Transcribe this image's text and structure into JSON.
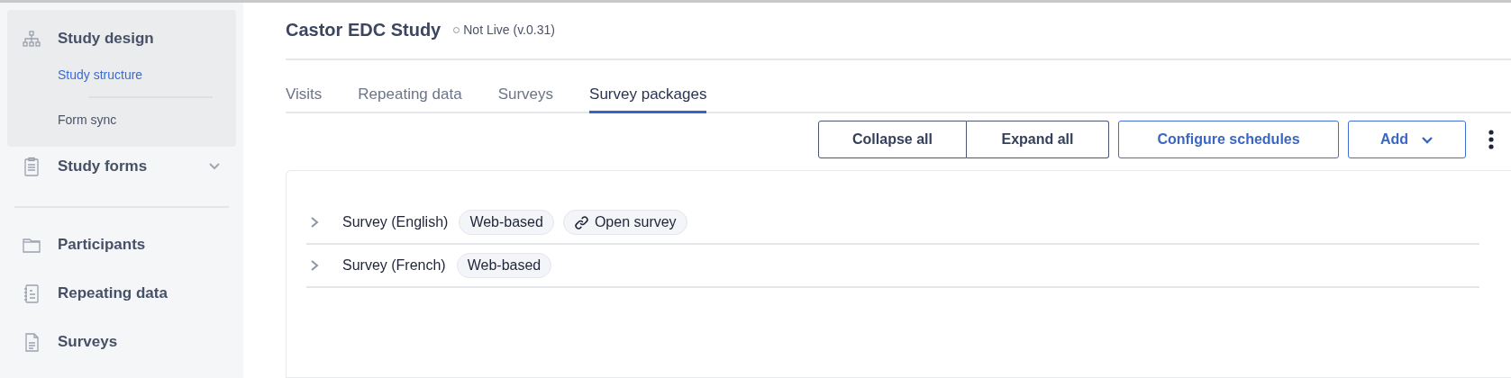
{
  "sidebar": {
    "sections": [
      [
        {
          "label": "Study design",
          "kind": "group",
          "expanded": true,
          "children": [
            {
              "label": "Study structure",
              "selected": true
            },
            {
              "label": "Form sync",
              "selected": false
            }
          ]
        },
        {
          "label": "Study forms",
          "kind": "group",
          "expanded": false
        }
      ],
      [
        {
          "label": "Participants",
          "kind": "link"
        },
        {
          "label": "Repeating data",
          "kind": "link"
        },
        {
          "label": "Surveys",
          "kind": "link"
        }
      ]
    ]
  },
  "header": {
    "title": "Castor EDC Study",
    "status": {
      "label": "Not Live (v.0.31)",
      "live": false
    }
  },
  "tabs": [
    {
      "label": "Visits",
      "selected": false
    },
    {
      "label": "Repeating data",
      "selected": false
    },
    {
      "label": "Surveys",
      "selected": false
    },
    {
      "label": "Survey packages",
      "selected": true
    }
  ],
  "toolbar": {
    "buttons": [
      {
        "label": "Collapse all",
        "kind": "segment"
      },
      {
        "label": "Expand all",
        "kind": "segment"
      },
      {
        "label": "Configure schedules",
        "kind": "outline"
      },
      {
        "label": "Add",
        "kind": "dropdown"
      }
    ]
  },
  "packages": [
    {
      "name": "Survey (English)",
      "expanded": false,
      "tags": [
        {
          "label": "Web-based",
          "kind": "tag"
        },
        {
          "label": "Open survey",
          "kind": "link"
        }
      ]
    },
    {
      "name": "Survey (French)",
      "expanded": false,
      "tags": [
        {
          "label": "Web-based",
          "kind": "tag"
        }
      ]
    }
  ]
}
